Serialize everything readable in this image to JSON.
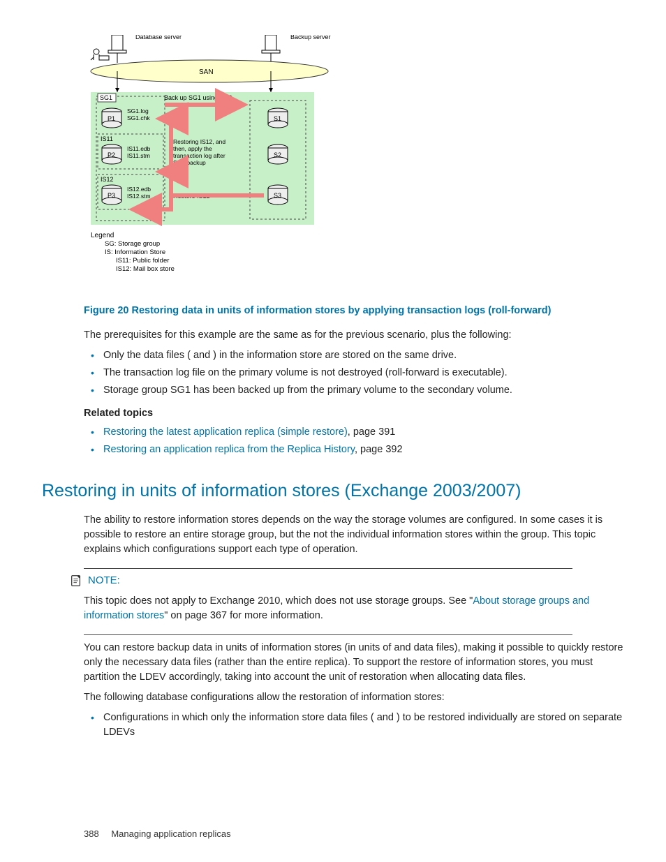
{
  "figure": {
    "db_server": "Database\nserver",
    "backup_server": "Backup\nserver",
    "san": "SAN",
    "sg1": "SG1",
    "backup_vss": "Back up SG1 using VSS",
    "p1": "P1",
    "p1_files": "SG1.log\nSG1.chk",
    "is11": "IS11",
    "p2": "P2",
    "p2_files": "IS11.edb\nIS11.stm",
    "restoring_text": "Restoring IS12, and\nthen, apply the\ntransaction log after\nSG1 backup",
    "is12": "IS12",
    "p3": "P3",
    "p3_files": "IS12.edb\nIS12.stm",
    "restore_is12": "Restore IS12",
    "s1": "S1",
    "s2": "S2",
    "s3": "S3",
    "legend_title": "Legend",
    "legend_sg": "SG: Storage group",
    "legend_is": "IS: Information Store",
    "legend_is11": "IS11: Public folder",
    "legend_is12": "IS12: Mail box store"
  },
  "caption": "Figure 20 Restoring data in units of information stores by applying transaction logs (roll-forward)",
  "prereq_intro": "The prerequisites for this example are the same as for the previous scenario, plus the following:",
  "prereq": [
    "Only the data files (           and          ) in the information store are stored on the same drive.",
    "The transaction log file on the primary volume is not destroyed (roll-forward is executable).",
    "Storage group SG1 has been backed up from the primary volume to the secondary volume."
  ],
  "related_heading": "Related topics",
  "related": [
    {
      "link": "Restoring the latest application replica (simple restore)",
      "suffix": ", page 391"
    },
    {
      "link": "Restoring an application replica from the Replica History",
      "suffix": ", page 392"
    }
  ],
  "section_title": "Restoring in units of information stores (Exchange 2003/2007)",
  "section_intro": "The ability to restore information stores depends on the way the storage volumes are configured. In some cases it is possible to restore an entire storage group, but the not the individual information stores within the group. This topic explains which configurations support each type of operation.",
  "note_label": "NOTE:",
  "note_body_pre": "This topic does not apply to Exchange 2010, which does not use storage groups. See \"",
  "note_link": "About storage groups and information stores",
  "note_body_post": "\" on page 367 for more information.",
  "para_restore": "You can restore backup data in units of information stores (in units of            and            data files), making it possible to quickly restore only the necessary data files (rather than the entire replica). To support the restore of information stores, you must partition the LDEV accordingly, taking into account the unit of restoration when allocating data files.",
  "para_following": "The following database configurations allow the restoration of information stores:",
  "config_bullet": "Configurations in which only the information store data files (          and          ) to be restored individually are stored on separate LDEVs",
  "footer_page": "388",
  "footer_text": "Managing application replicas"
}
